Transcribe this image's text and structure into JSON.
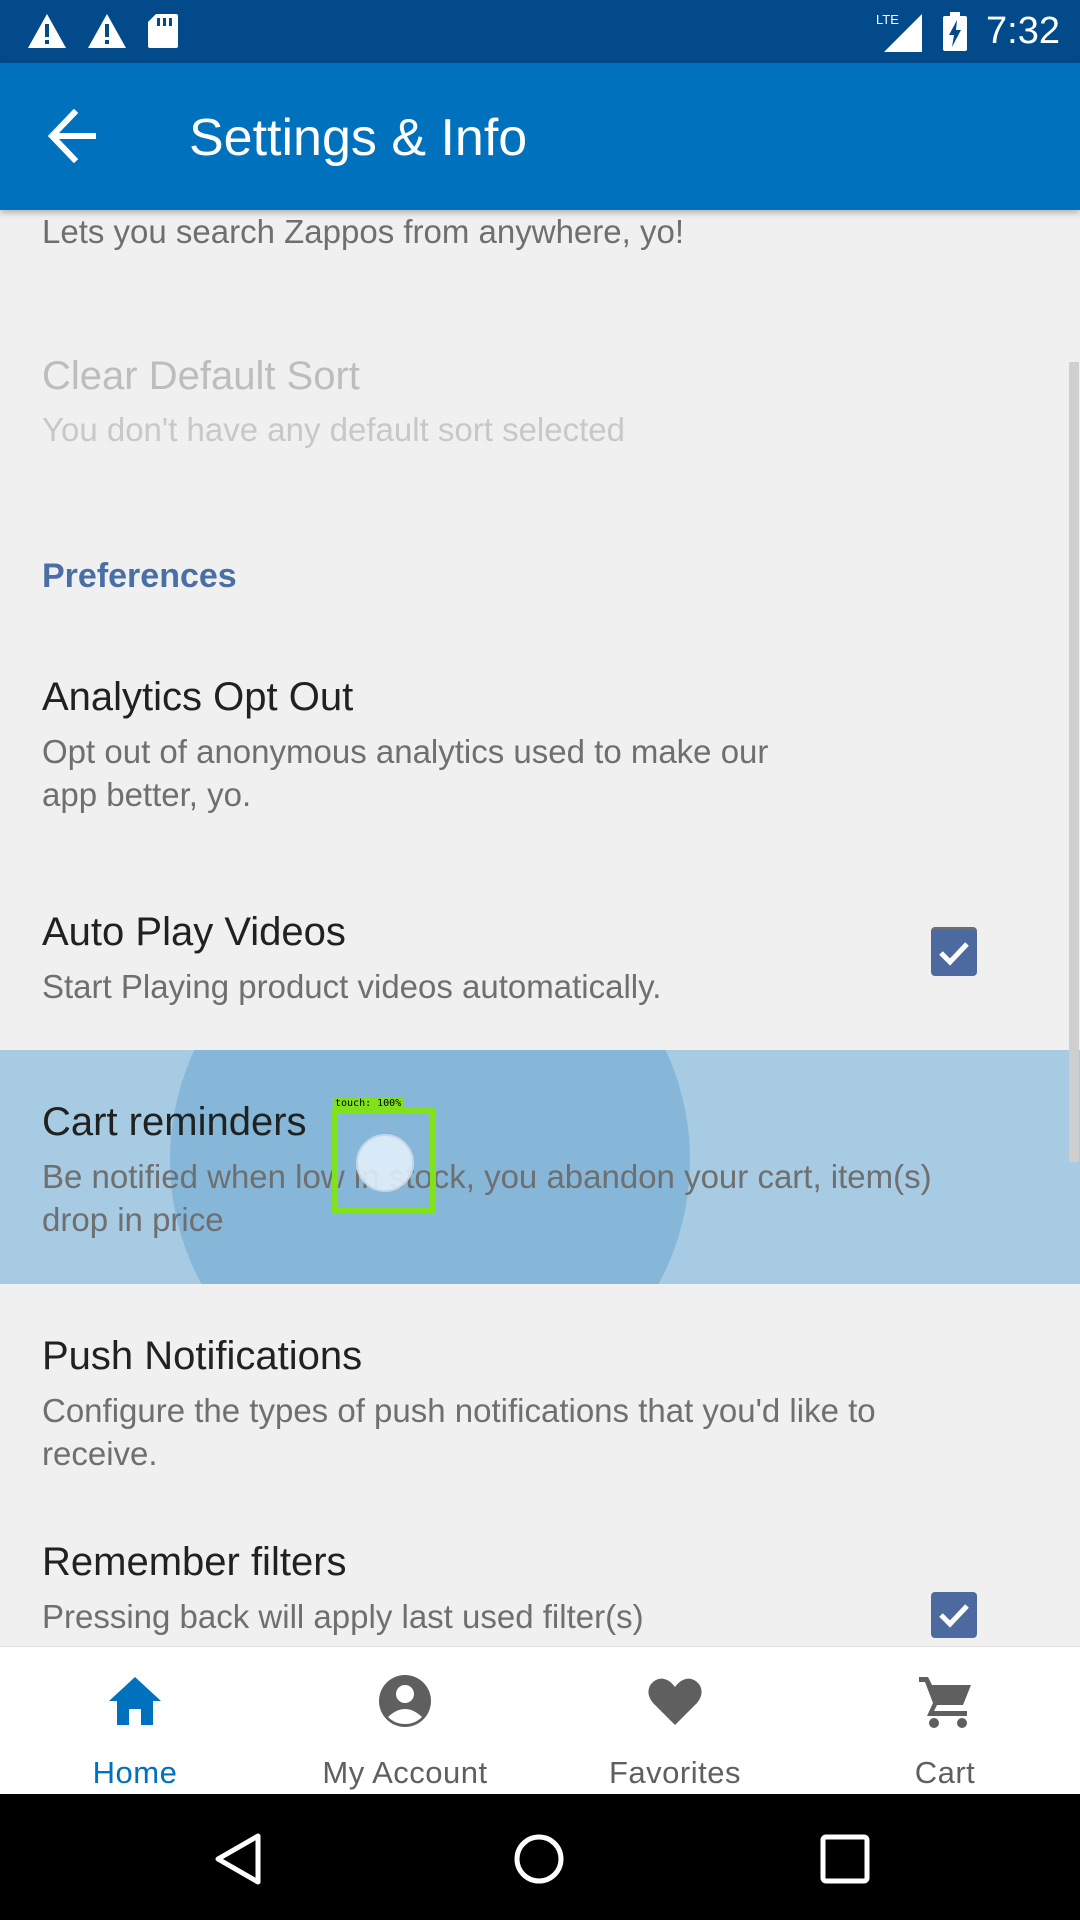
{
  "status_bar": {
    "time": "7:32",
    "network": "LTE"
  },
  "app_bar": {
    "title": "Settings & Info"
  },
  "items": {
    "search_widget_sub": "Lets you search Zappos from anywhere, yo!",
    "clear_sort": {
      "title": "Clear Default Sort",
      "sub": "You don't have any default sort selected"
    },
    "section_preferences": "Preferences",
    "analytics": {
      "title": "Analytics Opt Out",
      "sub_line1": "Opt out of anonymous analytics used to make our",
      "sub_line2": "app better, yo.",
      "checked": false
    },
    "autoplay": {
      "title": "Auto Play Videos",
      "sub": "Start Playing product videos automatically.",
      "checked": true
    },
    "cart_reminders": {
      "title": "Cart reminders",
      "sub_line1": "Be notified when low in stock, you abandon your cart, item(s)",
      "sub_line2": "drop in price"
    },
    "push": {
      "title": "Push Notifications",
      "sub_line1": "Configure the types of push notifications that you'd like to",
      "sub_line2": "receive."
    },
    "remember_filters": {
      "title": "Remember filters",
      "sub": "Pressing back will apply last used filter(s)",
      "checked": true
    }
  },
  "touch_overlay": {
    "label": "touch: 100%"
  },
  "bottom_nav": {
    "home": "Home",
    "account": "My Account",
    "favorites": "Favorites",
    "cart": "Cart"
  },
  "colors": {
    "status_bar": "#034a8a",
    "app_bar": "#0071bd",
    "checkbox_checked": "#4c6aa0",
    "section_header": "#4a6fa5",
    "highlight": "#a6cbe3"
  }
}
